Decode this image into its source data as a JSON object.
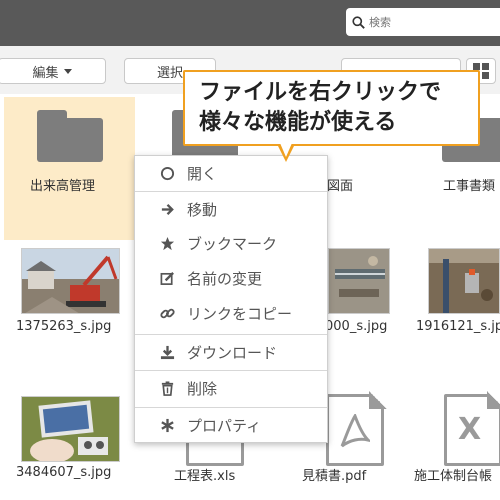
{
  "search": {
    "placeholder": "検索",
    "icon": "search-icon"
  },
  "toolbar": {
    "edit_label": "編集",
    "select_label": "選択",
    "grid_icon": "grid-icon"
  },
  "folders": [
    {
      "name": "出来高管理",
      "selected": true
    },
    {
      "name": "図面",
      "selected": false
    },
    {
      "name": "工事書類",
      "selected": false
    }
  ],
  "files": [
    {
      "name": "1375263_s.jpg",
      "type": "image"
    },
    {
      "name": "000_s.jpg",
      "type": "image"
    },
    {
      "name": "1916121_s.jpg",
      "type": "image"
    },
    {
      "name": "3484607_s.jpg",
      "type": "image"
    },
    {
      "name": "工程表.xls",
      "type": "excel"
    },
    {
      "name": "見積書.pdf",
      "type": "pdf"
    },
    {
      "name": "施工体制台帳",
      "type": "excel"
    }
  ],
  "context_menu": {
    "items": [
      {
        "label": "開く",
        "icon": "circle-icon"
      },
      {
        "label": "移動",
        "icon": "arrow-right-icon"
      },
      {
        "label": "ブックマーク",
        "icon": "star-icon"
      },
      {
        "label": "名前の変更",
        "icon": "edit-icon"
      },
      {
        "label": "リンクをコピー",
        "icon": "link-icon"
      },
      {
        "label": "ダウンロード",
        "icon": "download-icon"
      },
      {
        "label": "削除",
        "icon": "trash-icon"
      },
      {
        "label": "プロパティ",
        "icon": "asterisk-icon"
      }
    ]
  },
  "callout": {
    "line1": "ファイルを右クリックで",
    "line2": "様々な機能が使える",
    "border_color": "#f0a020"
  },
  "colors": {
    "topbar": "#595959",
    "selected_tile": "#fdebc8",
    "icon_gray": "#7d7d7d"
  }
}
